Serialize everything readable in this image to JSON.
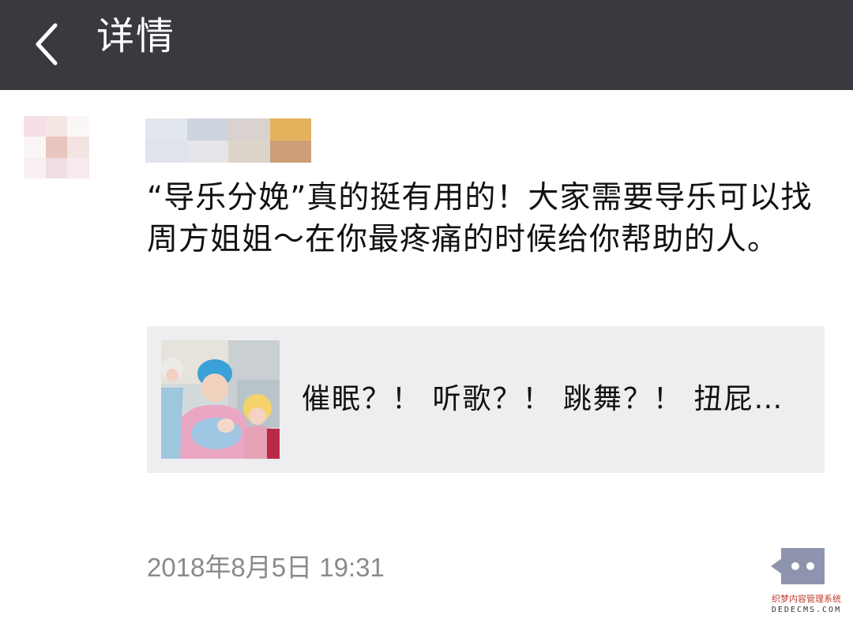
{
  "header": {
    "back_icon": "chevron-left-icon",
    "title": "详情"
  },
  "post": {
    "text": "“导乐分娩”真的挺有用的！大家需要导乐可以找周方姐姐～在你最疼痛的时候给你帮助的人。",
    "avatar_pixels": [
      "#f6dfe6",
      "#f3e6e3",
      "#fbf7f7",
      "#ffffff",
      "#ffffff",
      "#faf6f6",
      "#e8c5bd",
      "#f3e3e2",
      "#ffffff",
      "#ffffff",
      "#f7f0f2",
      "#efdde2",
      "#f7e9ee",
      "#ffffff",
      "#ffffff",
      "#ffffff",
      "#ffffff",
      "#ffffff",
      "#ffffff",
      "#ffffff",
      "#ffffff",
      "#ffffff",
      "#ffffff",
      "#ffffff",
      "#ffffff"
    ],
    "username_pixels": [
      "#e2e7ee",
      "#cdd4de",
      "#d9d2cf",
      "#e3b25c",
      "#dfe4ec",
      "#e4e6ea",
      "#ddd4cc",
      "#cc9f76"
    ]
  },
  "link_card": {
    "title": "催眠？！ 听歌？！ 跳舞？！ 扭屁…",
    "thumbnail": "photo-thumbnail"
  },
  "footer": {
    "timestamp": "2018年8月5日 19:31",
    "comment_icon": "comment-dots-icon"
  },
  "watermark": {
    "line1": "织梦内容管理系统",
    "line2": "DEDECMS.COM"
  },
  "colors": {
    "topbar": "#393a3f",
    "card_bg": "#eeeef1",
    "comment_btn": "#8e94ad",
    "timestamp": "#8a8a8a"
  }
}
